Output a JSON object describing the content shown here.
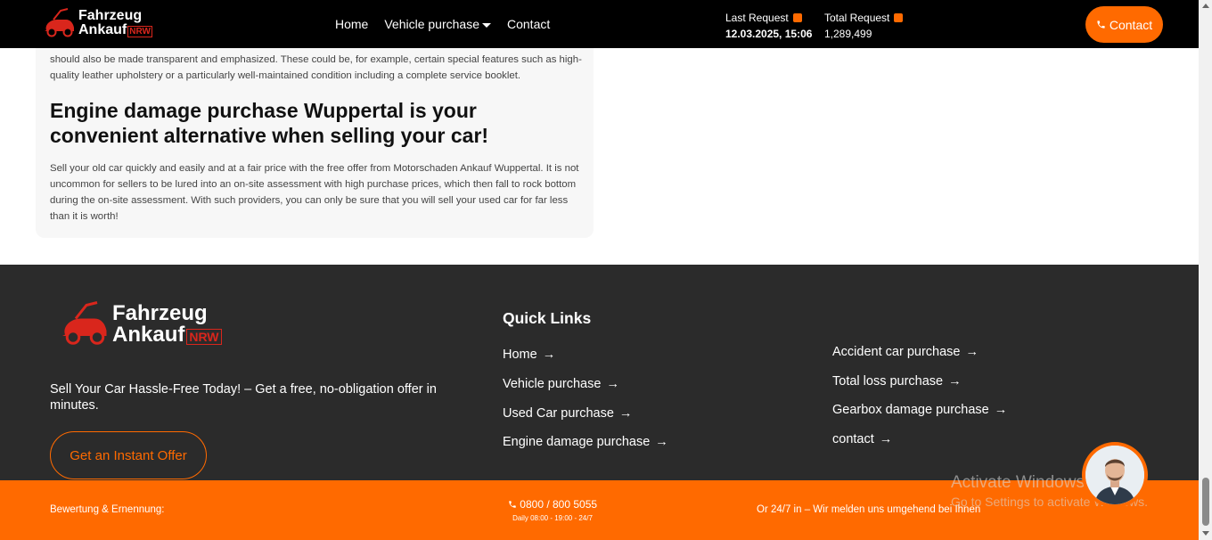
{
  "header": {
    "logo": {
      "line1": "Fahrzeug",
      "line2": "Ankauf",
      "badge": "NRW"
    },
    "nav": [
      "Home",
      "Vehicle purchase",
      "Contact"
    ],
    "last_request": {
      "label": "Last Request",
      "value": "12.03.2025, 15:06"
    },
    "total_request": {
      "label": "Total Request",
      "value": "1,289,499"
    },
    "contact_button": "Contact"
  },
  "content": {
    "para_top": "should also be made transparent and emphasized. These could be, for example, certain special features such as high-quality leather upholstery or a particularly well-maintained condition including a complete service booklet.",
    "heading": "Engine damage purchase Wuppertal is your convenient alternative when selling your car!",
    "para_bottom": "Sell your old car quickly and easily and at a fair price with the free offer from Motorschaden Ankauf Wuppertal.  It is not uncommon for sellers to be lured into an on-site assessment with high purchase prices, which then fall to rock bottom during the on-site assessment. With such providers, you can only be sure that you will sell your used car for far less than it is worth!"
  },
  "footer": {
    "logo": {
      "line1": "Fahrzeug",
      "line2": "Ankauf",
      "badge": "NRW"
    },
    "tagline": "Sell Your Car Hassle-Free Today! – Get a free, no-obligation offer in minutes.",
    "offer_button": "Get an Instant Offer",
    "quick_links_title": "Quick Links",
    "links_col1": [
      "Home",
      "Vehicle purchase",
      "Used Car purchase",
      "Engine damage purchase"
    ],
    "links_col2": [
      "Accident car purchase",
      "Total loss purchase",
      "Gearbox damage purchase",
      "contact"
    ]
  },
  "bottom_bar": {
    "left": "Bewertung & Ernennung:",
    "phone": "0800 / 800 5055",
    "hours": "Daily 08:00 - 19:00 - 24/7",
    "right": "Or 24/7 in – Wir melden uns umgehend bei Ihnen"
  },
  "watermark": {
    "title": "Activate Windows",
    "subtitle": "Go to Settings to activate Windows."
  },
  "colors": {
    "accent": "#ff6a00",
    "header_bg": "#000000",
    "footer_bg": "#2b2b2b",
    "logo_red": "#d9261c"
  }
}
